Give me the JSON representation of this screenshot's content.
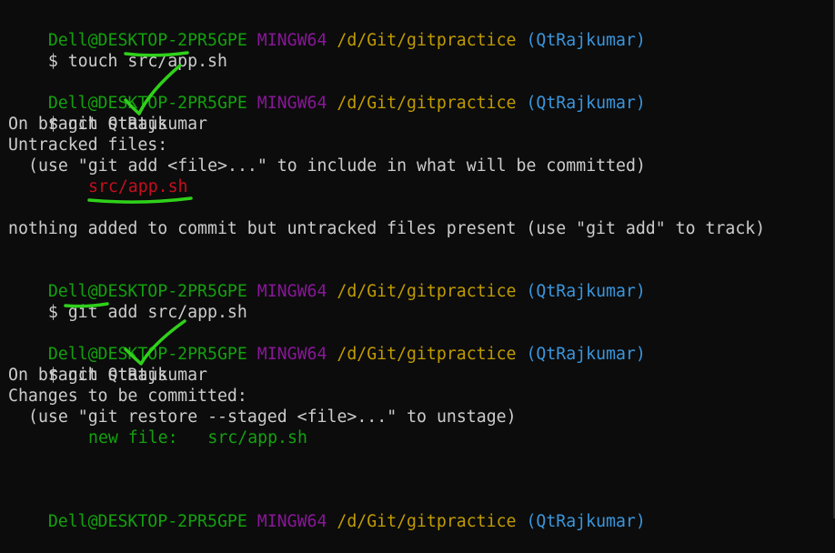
{
  "prompt": {
    "user": "Dell@DESKTOP-2PR5GPE",
    "system": "MINGW64",
    "path": "/d/Git/gitpractice",
    "branch": "(QtRajkumar)",
    "symbol": "$"
  },
  "commands": {
    "c1": "touch src/app.sh",
    "c2": "git status",
    "c3": "git add src/app.sh",
    "c4": "git status"
  },
  "output1": {
    "on_branch": "On branch QtRajkumar",
    "heading": "Untracked files:",
    "hint": "(use \"git add <file>...\" to include in what will be committed)",
    "file": "src/app.sh",
    "summary": "nothing added to commit but untracked files present (use \"git add\" to track)"
  },
  "output2": {
    "on_branch": "On branch QtRajkumar",
    "heading": "Changes to be committed:",
    "hint": "(use \"git restore --staged <file>...\" to unstage)",
    "new_file": "new file:   src/app.sh"
  },
  "annotations": {
    "color": "#2fd11a",
    "marks": [
      "underline-app-sh",
      "check-git-status-1",
      "underline-untracked-file",
      "underline-add",
      "check-git-status-2"
    ]
  }
}
